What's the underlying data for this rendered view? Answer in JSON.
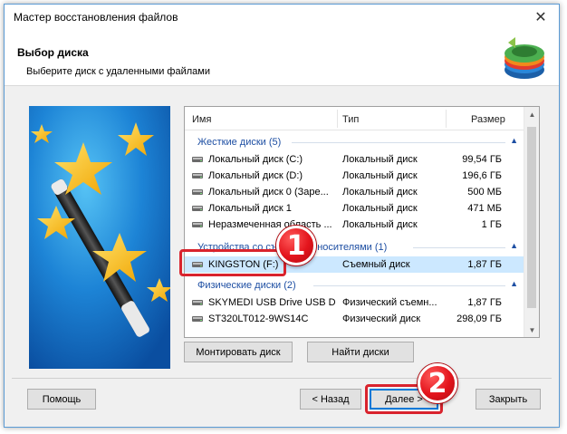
{
  "window": {
    "title": "Мастер восстановления файлов",
    "close_glyph": "✕"
  },
  "header": {
    "title": "Выбор диска",
    "subtitle": "Выберите диск с удаленными файлами",
    "logo_icon": "recovery-disk-logo-icon"
  },
  "columns": {
    "name": "Имя",
    "type": "Тип",
    "size": "Размер"
  },
  "groups": [
    {
      "label": "Жесткие диски (5)",
      "items": [
        {
          "name": "Локальный диск (C:)",
          "type": "Локальный диск",
          "size": "99,54 ГБ"
        },
        {
          "name": "Локальный диск (D:)",
          "type": "Локальный диск",
          "size": "196,6 ГБ"
        },
        {
          "name": "Локальный диск 0 (Заре...",
          "type": "Локальный диск",
          "size": "500 МБ"
        },
        {
          "name": "Локальный диск 1",
          "type": "Локальный диск",
          "size": "471 МБ"
        },
        {
          "name": "Неразмеченная область ...",
          "type": "Локальный диск",
          "size": "1 ГБ"
        }
      ]
    },
    {
      "label": "Устройства со съемными носителями (1)",
      "items": [
        {
          "name": "KINGSTON (F:)",
          "type": "Съемный диск",
          "size": "1,87 ГБ",
          "selected": true
        }
      ]
    },
    {
      "label": "Физические диски (2)",
      "items": [
        {
          "name": "SKYMEDI USB Drive USB D...",
          "type": "Физический съемн...",
          "size": "1,87 ГБ"
        },
        {
          "name": "ST320LT012-9WS14C",
          "type": "Физический диск",
          "size": "298,09 ГБ"
        }
      ]
    }
  ],
  "buttons": {
    "mount": "Монтировать диск",
    "find": "Найти диски",
    "help": "Помощь",
    "back": "< Назад",
    "next": "Далее >",
    "close": "Закрыть"
  },
  "callouts": {
    "one": "1",
    "two": "2",
    "color": "#d9232d"
  },
  "colors": {
    "group_header": "#1e4fa3",
    "selection": "#cce8ff",
    "accent": "#0078d7"
  }
}
